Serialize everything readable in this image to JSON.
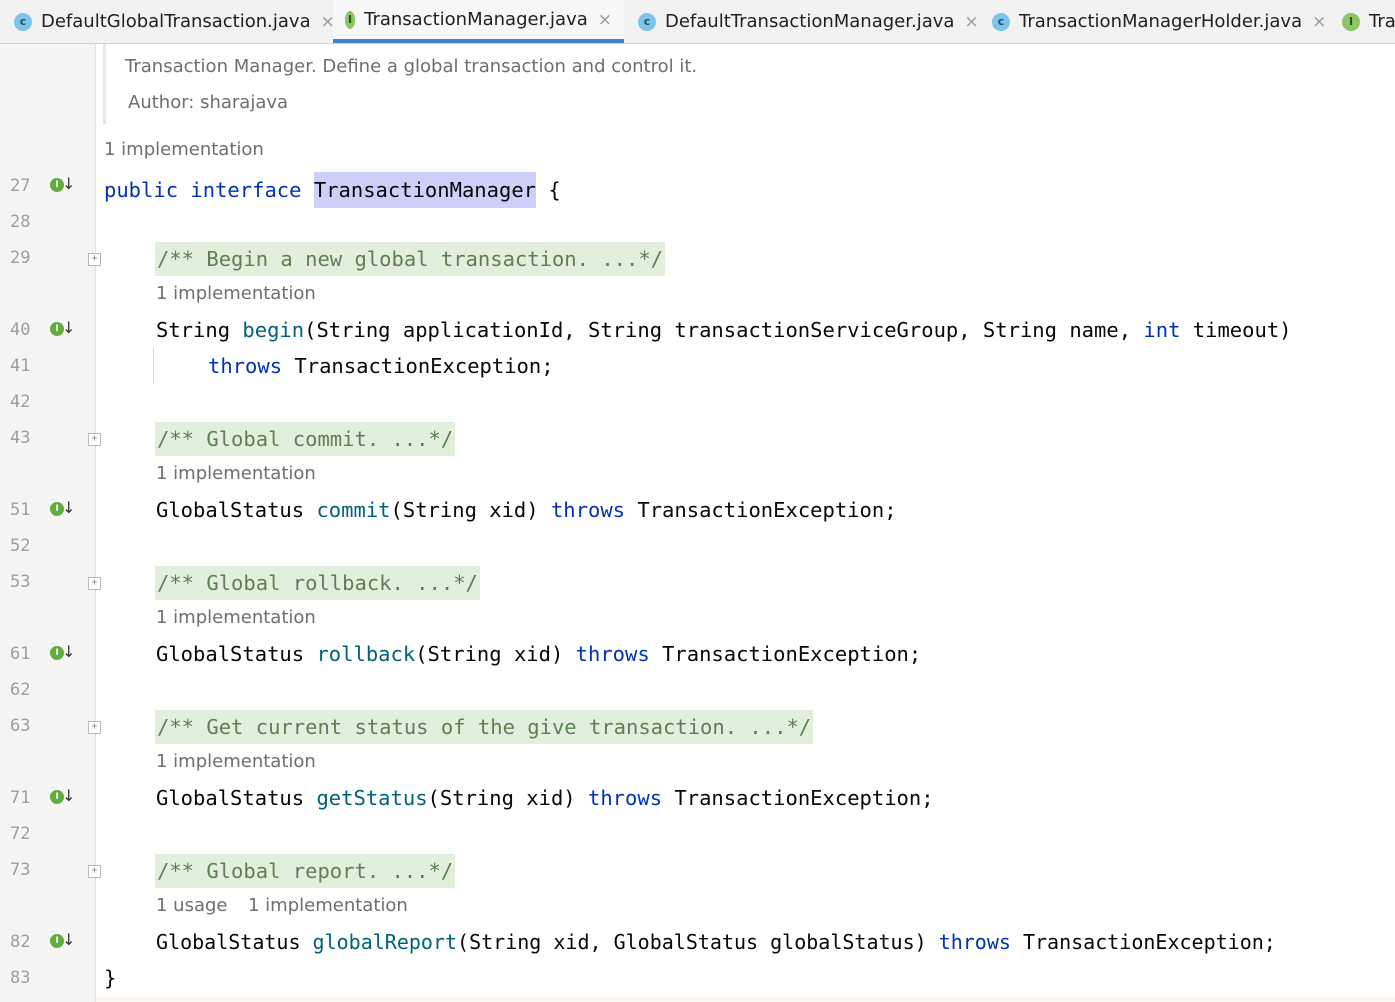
{
  "tabs": [
    {
      "label": "DefaultGlobalTransaction.java",
      "icon": "c-class-icon",
      "icon_letter": "c",
      "active": false
    },
    {
      "label": "TransactionManager.java",
      "icon": "interface-icon",
      "icon_letter": "I",
      "active": true
    },
    {
      "label": "DefaultTransactionManager.java",
      "icon": "c-class-icon",
      "icon_letter": "c",
      "active": false
    },
    {
      "label": "TransactionManagerHolder.java",
      "icon": "c-class-icon",
      "icon_letter": "c",
      "active": false
    },
    {
      "label": "Tra",
      "icon": "interface-icon",
      "icon_letter": "I",
      "active": false
    }
  ],
  "close_glyph": "×",
  "doc": {
    "description": "Transaction Manager. Define a global transaction and control it.",
    "author": "Author: sharajava"
  },
  "gutter_icon_letter": "I",
  "gutter_arrow": "↓",
  "fold_glyph": "+",
  "line_numbers": [
    "27",
    "28",
    "29",
    "40",
    "41",
    "42",
    "43",
    "51",
    "52",
    "53",
    "61",
    "62",
    "63",
    "71",
    "72",
    "73",
    "82",
    "83"
  ],
  "hints": {
    "h1": "1 implementation",
    "h2": "1 implementation",
    "h3": "1 implementation",
    "h4": "1 implementation",
    "h5": "1 implementation",
    "h6_usage": "1 usage",
    "h6_impl": "1 implementation"
  },
  "code": {
    "l27_kw1": "public",
    "l27_kw2": "interface",
    "l27_name": "TransactionManager",
    "l27_brace": " {",
    "l29_comment": "/** Begin a new global transaction. ...*/",
    "l40_type": "String ",
    "l40_method": "begin",
    "l40_params": "(String applicationId, String transactionServiceGroup, String name, ",
    "l40_int": "int",
    "l40_end": " timeout)",
    "l41_throws": "throws",
    "l41_exc": " TransactionException;",
    "l43_comment": "/** Global commit. ...*/",
    "l51_type": "GlobalStatus ",
    "l51_method": "commit",
    "l51_params": "(String xid) ",
    "l51_throws": "throws",
    "l51_exc": " TransactionException;",
    "l53_comment": "/** Global rollback. ...*/",
    "l61_type": "GlobalStatus ",
    "l61_method": "rollback",
    "l61_params": "(String xid) ",
    "l61_throws": "throws",
    "l61_exc": " TransactionException;",
    "l63_comment": "/** Get current status of the give transaction. ...*/",
    "l71_type": "GlobalStatus ",
    "l71_method": "getStatus",
    "l71_params": "(String xid) ",
    "l71_throws": "throws",
    "l71_exc": " TransactionException;",
    "l73_comment": "/** Global report. ...*/",
    "l82_type": "GlobalStatus ",
    "l82_method": "globalReport",
    "l82_params": "(String xid, GlobalStatus globalStatus) ",
    "l82_throws": "throws",
    "l82_exc": " TransactionException;",
    "l83_brace": "}"
  },
  "colors": {
    "keyword": "#0033b3",
    "method": "#00627a",
    "comment_bg": "#e3efdd",
    "comment_text": "#5e7f52",
    "highlight": "#cdd0f8",
    "active_tab_underline": "#4083c9"
  }
}
